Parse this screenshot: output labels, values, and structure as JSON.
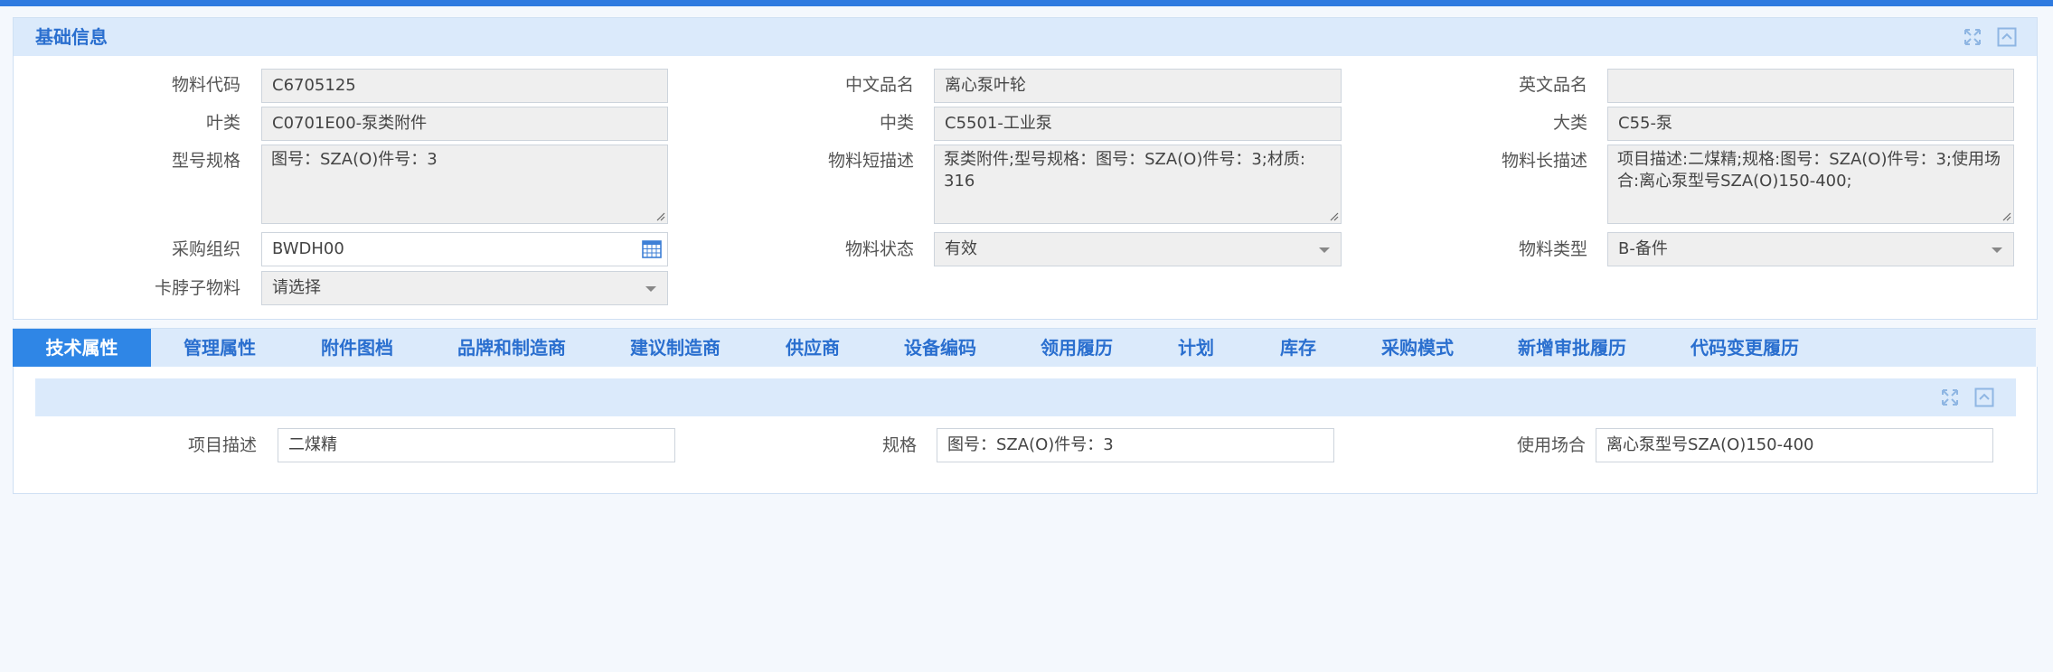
{
  "colors": {
    "accent": "#2f7be0",
    "header_bg": "#dbeafb",
    "title": "#2a6fcf"
  },
  "basic_info": {
    "title": "基础信息",
    "icons": [
      "expand-icon",
      "collapse-icon"
    ],
    "fields": {
      "material_code": {
        "label": "物料代码",
        "value": "C6705125"
      },
      "chinese_name": {
        "label": "中文品名",
        "value": "离心泵叶轮"
      },
      "english_name": {
        "label": "英文品名",
        "value": ""
      },
      "leaf_class": {
        "label": "叶类",
        "value": "C0701E00-泵类附件"
      },
      "middle_class": {
        "label": "中类",
        "value": "C5501-工业泵"
      },
      "major_class": {
        "label": "大类",
        "value": "C55-泵"
      },
      "model_spec": {
        "label": "型号规格",
        "value": "图号：SZA(O)件号：3"
      },
      "short_desc": {
        "label": "物料短描述",
        "value": "泵类附件;型号规格：图号：SZA(O)件号：3;材质: 316"
      },
      "long_desc": {
        "label": "物料长描述",
        "value": "项目描述:二煤精;规格:图号：SZA(O)件号：3;使用场合:离心泵型号SZA(O)150-400;"
      },
      "purchase_org": {
        "label": "采购组织",
        "value": "BWDH00"
      },
      "material_status": {
        "label": "物料状态",
        "value": "有效"
      },
      "material_type": {
        "label": "物料类型",
        "value": "B-备件"
      },
      "neck_material": {
        "label": "卡脖子物料",
        "value": "请选择"
      }
    }
  },
  "tabs": [
    {
      "label": "技术属性",
      "active": true
    },
    {
      "label": "管理属性"
    },
    {
      "label": "附件图档"
    },
    {
      "label": "品牌和制造商"
    },
    {
      "label": "建议制造商"
    },
    {
      "label": "供应商"
    },
    {
      "label": "设备编码"
    },
    {
      "label": "领用履历"
    },
    {
      "label": "计划"
    },
    {
      "label": "库存"
    },
    {
      "label": "采购模式"
    },
    {
      "label": "新增审批履历"
    },
    {
      "label": "代码变更履历"
    }
  ],
  "tech_attributes": {
    "project_desc": {
      "label": "项目描述",
      "value": "二煤精"
    },
    "spec": {
      "label": "规格",
      "value": "图号：SZA(O)件号：3"
    },
    "usage": {
      "label": "使用场合",
      "value": "离心泵型号SZA(O)150-400"
    }
  }
}
